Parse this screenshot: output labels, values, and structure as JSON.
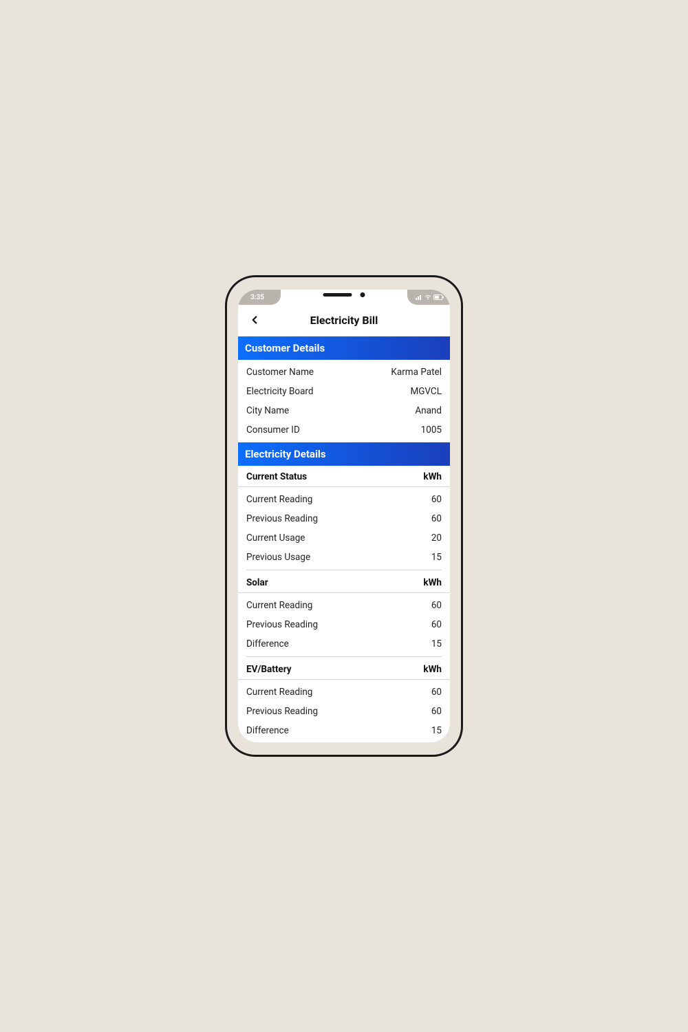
{
  "status": {
    "time": "3:35"
  },
  "header": {
    "title": "Electricity Bill"
  },
  "sections": {
    "customer": {
      "title": "Customer Details",
      "rows": [
        {
          "label": "Customer Name",
          "value": "Karma Patel"
        },
        {
          "label": "Electricity Board",
          "value": "MGVCL"
        },
        {
          "label": "City Name",
          "value": "Anand"
        },
        {
          "label": "Consumer ID",
          "value": "1005"
        }
      ]
    },
    "electricity": {
      "title": "Electricity Details",
      "groups": [
        {
          "heading": "Current Status",
          "unit": "kWh",
          "rows": [
            {
              "label": "Current Reading",
              "value": "60"
            },
            {
              "label": "Previous Reading",
              "value": "60"
            },
            {
              "label": "Current Usage",
              "value": "20"
            },
            {
              "label": "Previous Usage",
              "value": "15"
            }
          ]
        },
        {
          "heading": "Solar",
          "unit": "kWh",
          "rows": [
            {
              "label": "Current Reading",
              "value": "60"
            },
            {
              "label": "Previous Reading",
              "value": "60"
            },
            {
              "label": "Difference",
              "value": "15"
            }
          ]
        },
        {
          "heading": "EV/Battery",
          "unit": "kWh",
          "rows": [
            {
              "label": "Current Reading",
              "value": "60"
            },
            {
              "label": "Previous Reading",
              "value": "60"
            },
            {
              "label": "Difference",
              "value": "15"
            }
          ]
        }
      ]
    }
  }
}
